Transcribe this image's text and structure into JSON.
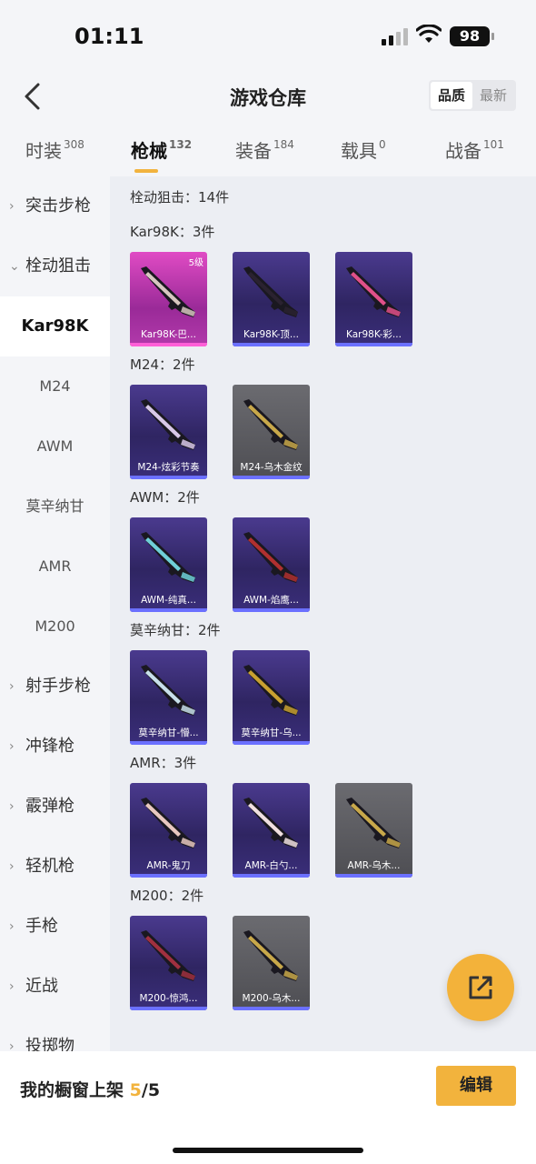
{
  "status": {
    "time": "01:11",
    "battery": "98"
  },
  "header": {
    "title": "游戏仓库",
    "sort_options": [
      "品质",
      "最新"
    ],
    "sort_selected": "品质"
  },
  "tabs": [
    {
      "label": "时装",
      "count": "308"
    },
    {
      "label": "枪械",
      "count": "132",
      "active": true
    },
    {
      "label": "装备",
      "count": "184"
    },
    {
      "label": "载具",
      "count": "0"
    },
    {
      "label": "战备",
      "count": "101"
    }
  ],
  "sidebar": [
    {
      "label": "突击步枪",
      "type": "group",
      "chev": "›"
    },
    {
      "label": "栓动狙击",
      "type": "group",
      "chev": "⌄"
    },
    {
      "label": "Kar98K",
      "type": "sub",
      "selected": true
    },
    {
      "label": "M24",
      "type": "sub"
    },
    {
      "label": "AWM",
      "type": "sub"
    },
    {
      "label": "莫辛纳甘",
      "type": "sub"
    },
    {
      "label": "AMR",
      "type": "sub"
    },
    {
      "label": "M200",
      "type": "sub"
    },
    {
      "label": "射手步枪",
      "type": "group",
      "chev": "›"
    },
    {
      "label": "冲锋枪",
      "type": "group",
      "chev": "›"
    },
    {
      "label": "霰弹枪",
      "type": "group",
      "chev": "›"
    },
    {
      "label": "轻机枪",
      "type": "group",
      "chev": "›"
    },
    {
      "label": "手枪",
      "type": "group",
      "chev": "›"
    },
    {
      "label": "近战",
      "type": "group",
      "chev": "›"
    },
    {
      "label": "投掷物",
      "type": "group",
      "chev": "›"
    }
  ],
  "content": {
    "summary": "栓动狙击：14件",
    "sections": [
      {
        "title": "Kar98K：3件",
        "items": [
          {
            "label": "Kar98K-巴...",
            "style": "pink",
            "level": "5级",
            "accent": "#d7c7c0"
          },
          {
            "label": "Kar98K-顶...",
            "style": "purple",
            "accent": "#2a2230"
          },
          {
            "label": "Kar98K-彩...",
            "style": "purple",
            "accent": "#e0508a"
          }
        ]
      },
      {
        "title": "M24：2件",
        "items": [
          {
            "label": "M24-炫彩节奏",
            "style": "purple",
            "accent": "#d8c8e8"
          },
          {
            "label": "M24-乌木金纹",
            "style": "gray",
            "accent": "#c8a84a"
          }
        ]
      },
      {
        "title": "AWM：2件",
        "items": [
          {
            "label": "AWM-纯真...",
            "style": "purple",
            "accent": "#6fd0d8"
          },
          {
            "label": "AWM-焰鹰...",
            "style": "purple",
            "accent": "#b03030"
          }
        ]
      },
      {
        "title": "莫辛纳甘：2件",
        "items": [
          {
            "label": "莫辛纳甘-懵...",
            "style": "purple",
            "accent": "#c8e0ea"
          },
          {
            "label": "莫辛纳甘-乌...",
            "style": "purple",
            "accent": "#c8a030"
          }
        ]
      },
      {
        "title": "AMR：3件",
        "items": [
          {
            "label": "AMR-鬼刀",
            "style": "purple",
            "accent": "#e8c8c0"
          },
          {
            "label": "AMR-白勺...",
            "style": "purple",
            "accent": "#f0e0e0"
          },
          {
            "label": "AMR-乌木...",
            "style": "gray",
            "accent": "#c8a84a"
          }
        ]
      },
      {
        "title": "M200：2件",
        "items": [
          {
            "label": "M200-惊鸿...",
            "style": "purple",
            "accent": "#a03040"
          },
          {
            "label": "M200-乌木...",
            "style": "gray",
            "accent": "#c8a84a"
          }
        ]
      }
    ]
  },
  "bottom": {
    "label": "我的橱窗上架",
    "shelf_count": "5",
    "shelf_total": "/5",
    "edit_label": "编辑"
  }
}
